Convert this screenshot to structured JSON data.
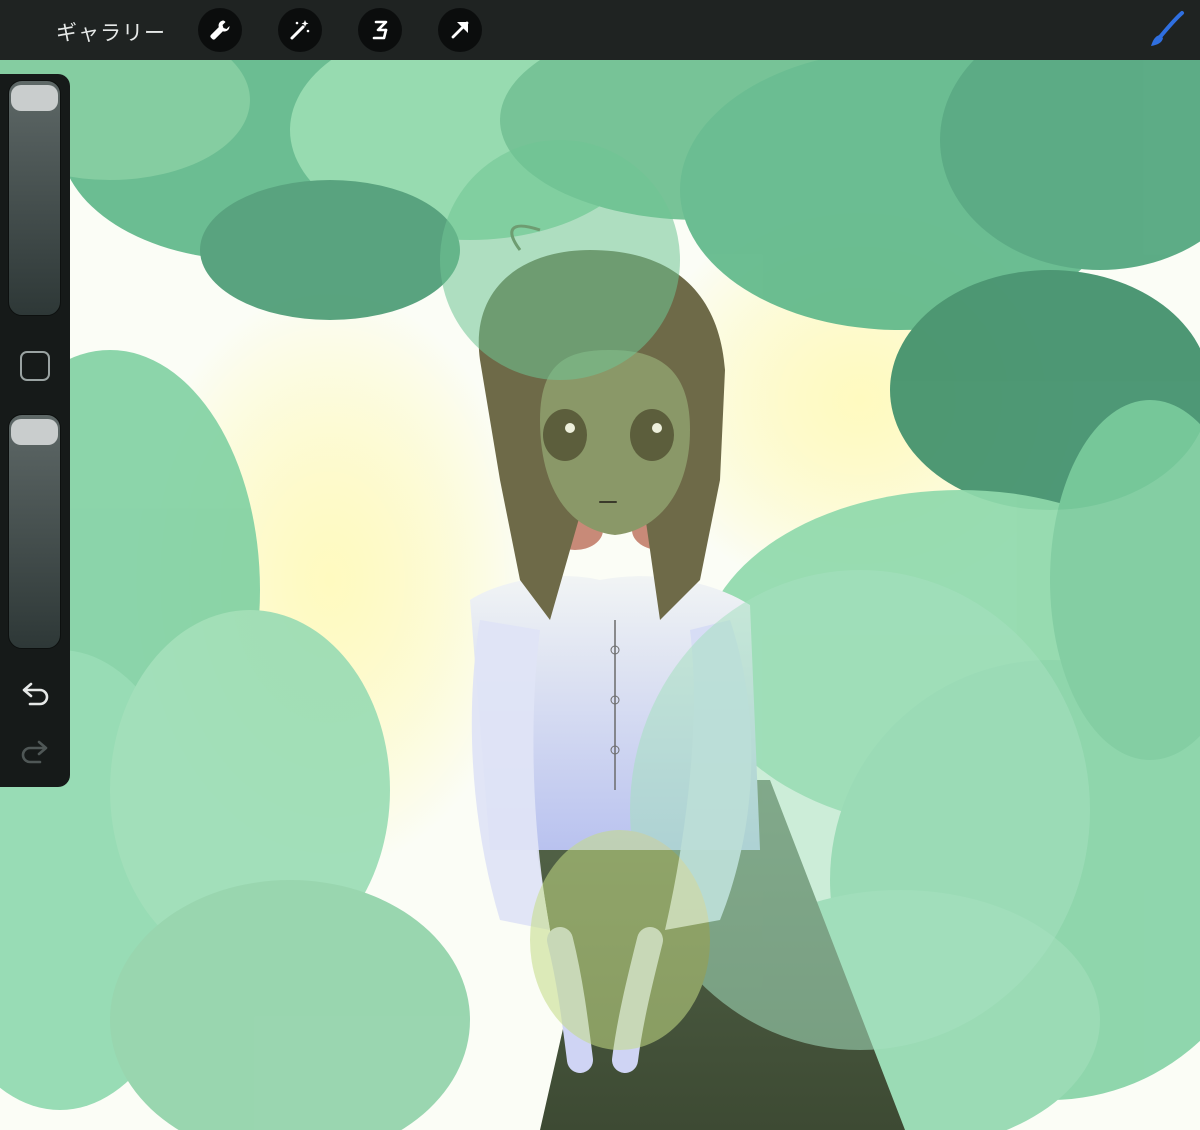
{
  "toolbar": {
    "gallery_label": "ギャラリー",
    "tools": [
      {
        "name": "wrench-icon"
      },
      {
        "name": "magic-wand-icon"
      },
      {
        "name": "selection-icon"
      },
      {
        "name": "move-arrow-icon"
      }
    ],
    "active_tool": "brush-icon",
    "accent_color": "#2f6fe0"
  },
  "sidebar": {
    "brush_size": 0.0,
    "brush_opacity": 0.0,
    "modify_button_icon": "square-icon",
    "undo_icon": "undo-icon",
    "redo_icon": "redo-icon"
  },
  "canvas": {
    "subject": "illustration",
    "colors": {
      "leaf_light": "#8fd9ab",
      "leaf_mid": "#5fb88a",
      "leaf_dark": "#3f8f6a",
      "sunlight": "#fff7a0",
      "hair": "#6e6a48",
      "skirt": "#4a5a3a",
      "blouse": "#e6ecf8",
      "bow": "#c88a78"
    }
  }
}
